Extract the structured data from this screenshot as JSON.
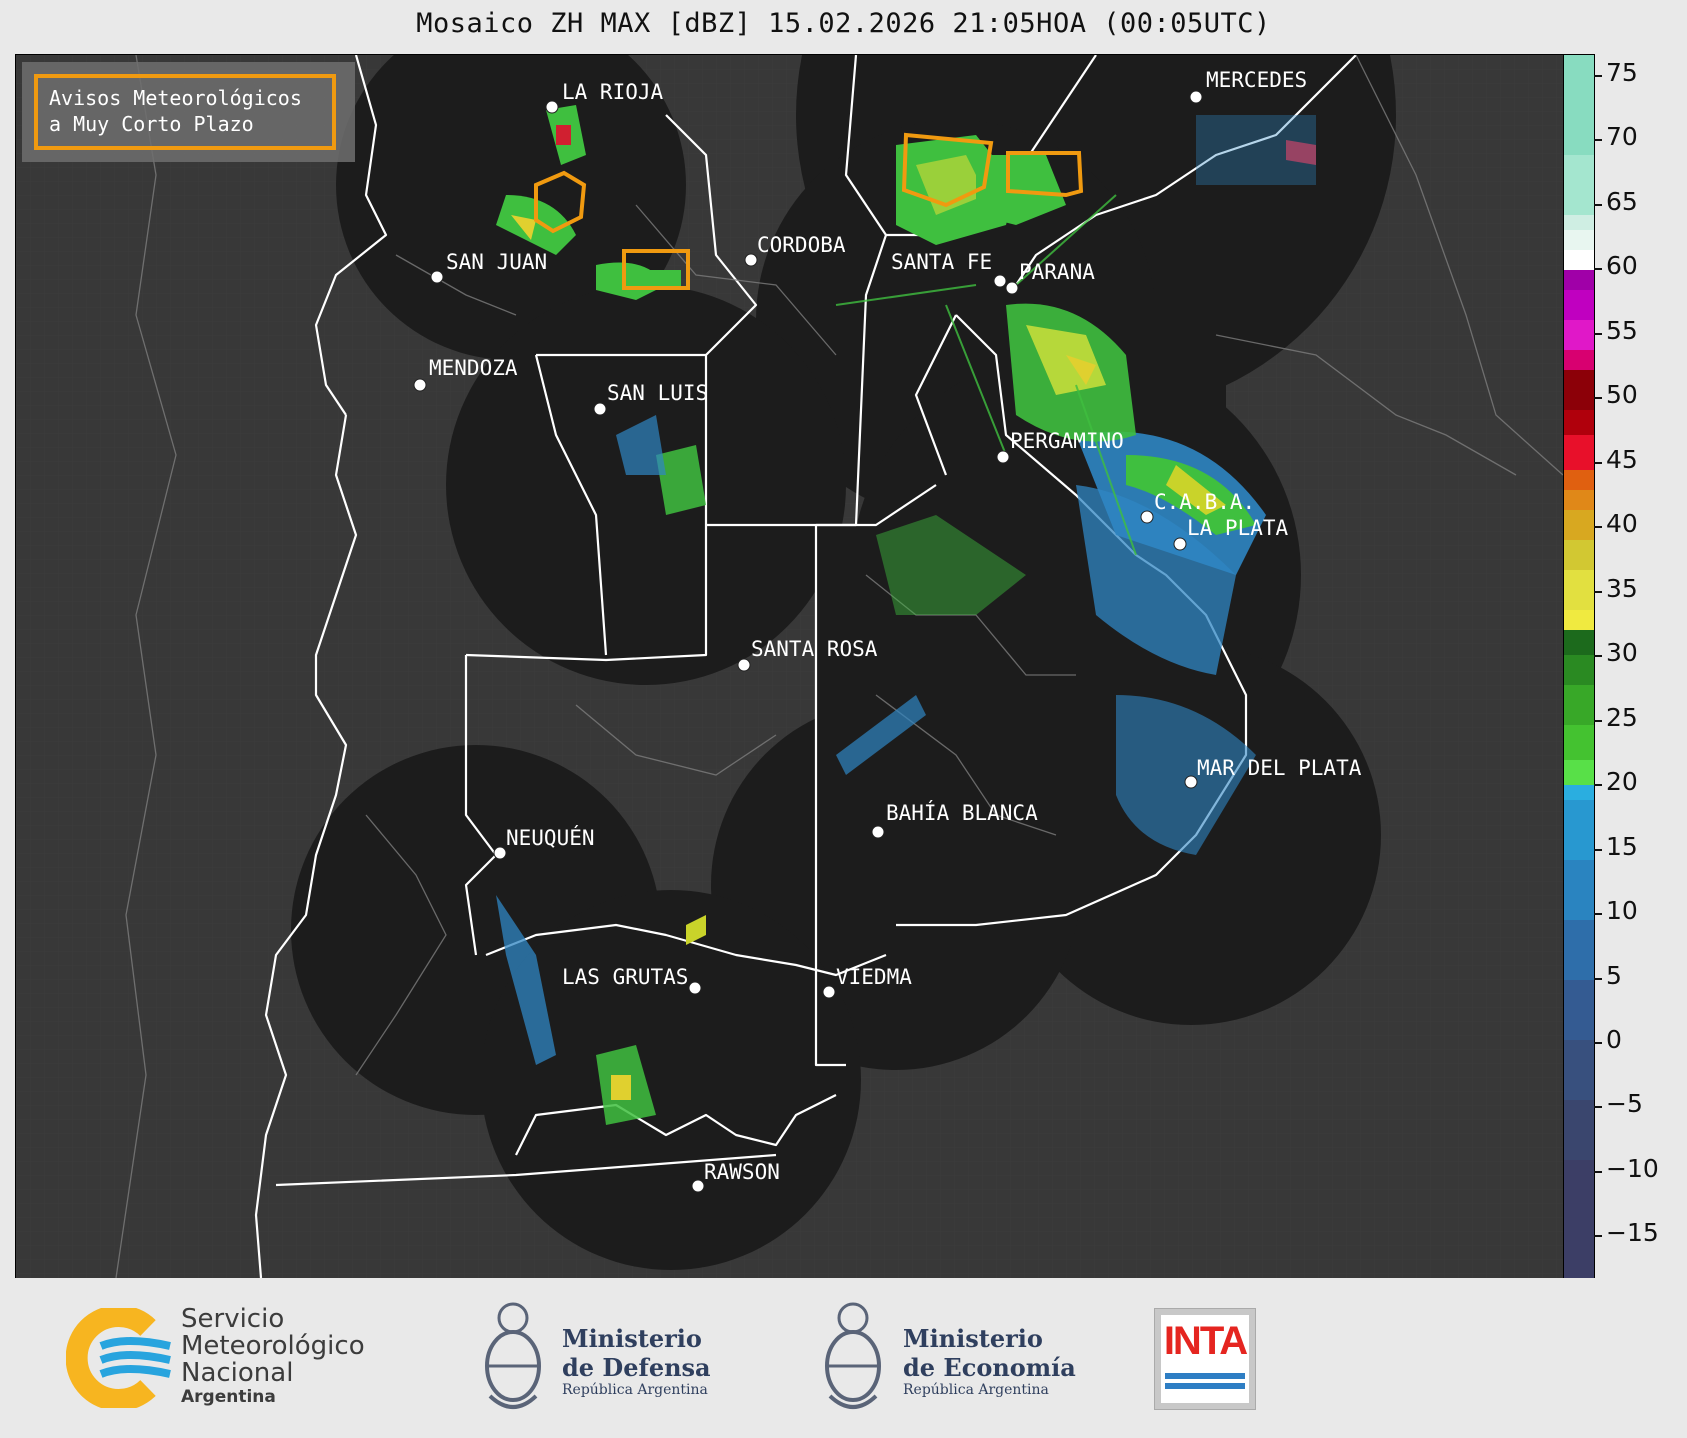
{
  "title": "Mosaico ZH MAX [dBZ] 15.02.2026 21:05HOA (00:05UTC)",
  "legend": {
    "line1": "Avisos Meteorológicos",
    "line2": "a Muy Corto Plazo",
    "color": "#f09a10"
  },
  "cities": [
    {
      "name": "LA RIOJA"
    },
    {
      "name": "MERCEDES"
    },
    {
      "name": "SAN JUAN"
    },
    {
      "name": "CORDOBA"
    },
    {
      "name": "SANTA FE"
    },
    {
      "name": "PARANA"
    },
    {
      "name": "MENDOZA"
    },
    {
      "name": "SAN LUIS"
    },
    {
      "name": "PERGAMINO"
    },
    {
      "name": "C.A.B.A."
    },
    {
      "name": "LA PLATA"
    },
    {
      "name": "SANTA ROSA"
    },
    {
      "name": "MAR DEL PLATA"
    },
    {
      "name": "BAHÍA BLANCA"
    },
    {
      "name": "NEUQUÉN"
    },
    {
      "name": "LAS GRUTAS"
    },
    {
      "name": "VIEDMA"
    },
    {
      "name": "RAWSON"
    }
  ],
  "colorbar": {
    "unit": "dBZ",
    "ticks": [
      "75",
      "70",
      "65",
      "60",
      "55",
      "50",
      "45",
      "40",
      "35",
      "30",
      "25",
      "20",
      "15",
      "10",
      "5",
      "0",
      "−5",
      "−10",
      "−15"
    ]
  },
  "footer": {
    "smn": {
      "line1": "Servicio",
      "line2": "Meteorológico",
      "line3": "Nacional",
      "line4": "Argentina"
    },
    "defensa": {
      "line1": "Ministerio",
      "line2": "de Defensa",
      "line3": "República Argentina"
    },
    "economia": {
      "line1": "Ministerio",
      "line2": "de Economía",
      "line3": "República Argentina"
    },
    "inta": {
      "label": "INTA"
    }
  }
}
